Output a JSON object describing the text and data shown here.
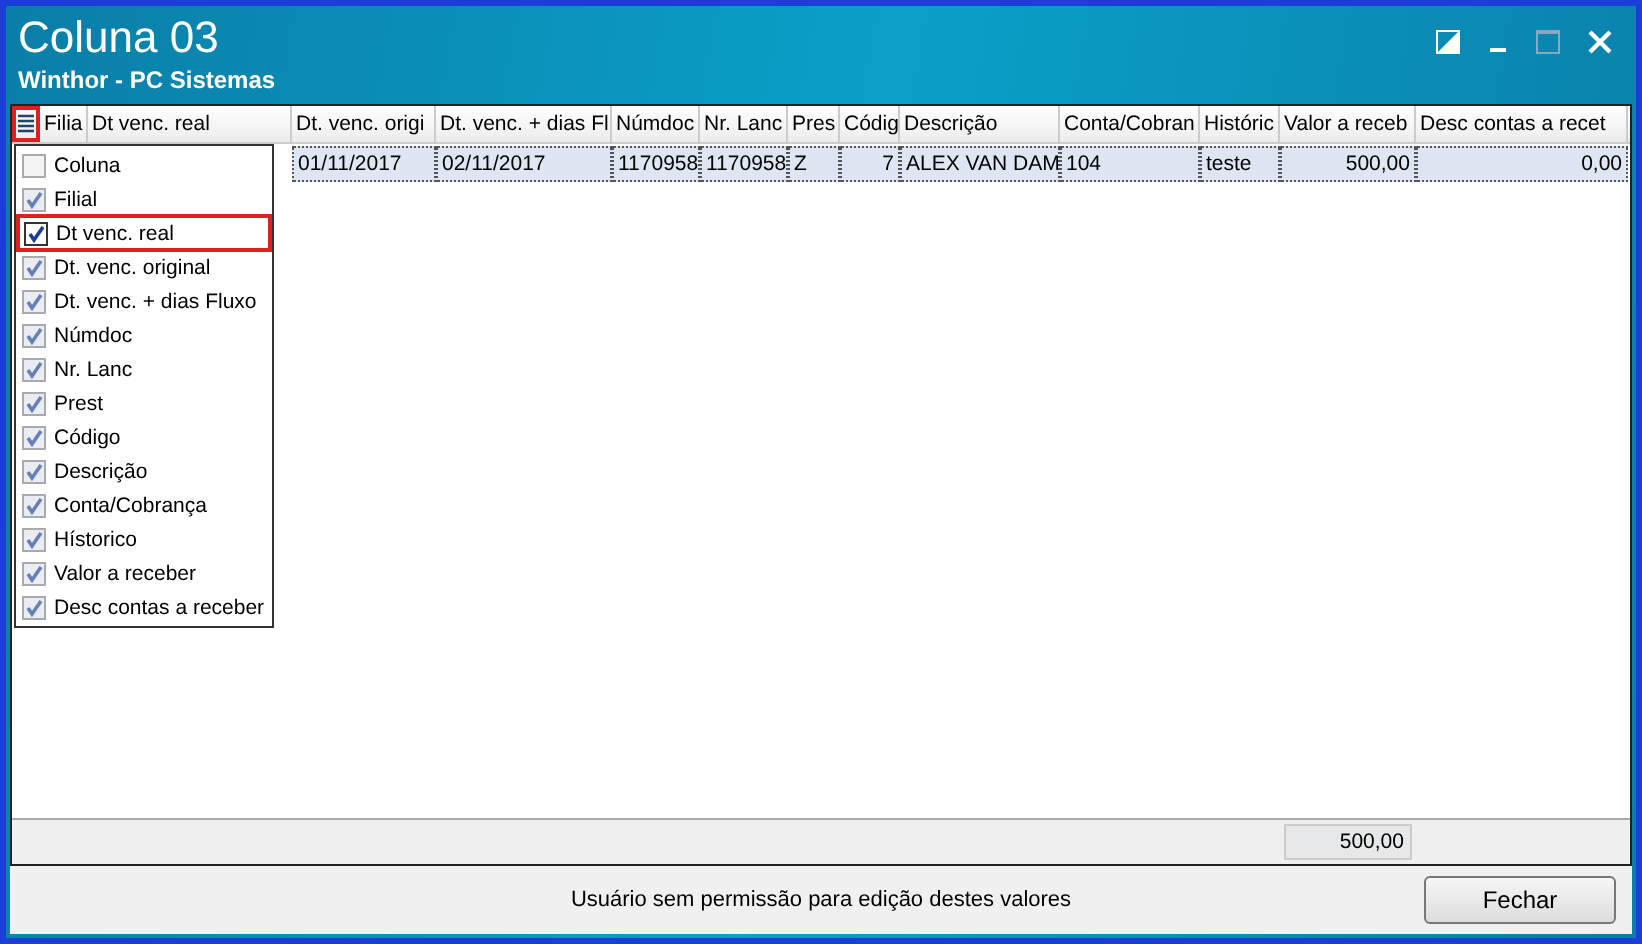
{
  "window": {
    "title": "Coluna 03",
    "subtitle": "Winthor - PC Sistemas"
  },
  "table": {
    "columns": [
      "Filia",
      "Dt venc. real",
      "Dt. venc. origi",
      "Dt. venc. + dias Fl",
      "Númdoc",
      "Nr. Lanc",
      "Pres",
      "Códig",
      "Descrição",
      "Conta/Cobran",
      "Históric",
      "Valor a receb",
      "Desc contas a recet"
    ],
    "rows": [
      {
        "selected": true,
        "cells": [
          "",
          "",
          "01/11/2017",
          "02/11/2017",
          "1170958",
          "1170958",
          "Z",
          "7",
          "ALEX VAN DAM",
          "104",
          "teste",
          "500,00",
          "0,00"
        ]
      }
    ],
    "total_value": "500,00"
  },
  "column_menu": {
    "items": [
      {
        "label": "Coluna",
        "checked": false,
        "selected": false
      },
      {
        "label": "Filial",
        "checked": true,
        "selected": false
      },
      {
        "label": "Dt venc. real",
        "checked": true,
        "selected": true
      },
      {
        "label": "Dt. venc. original",
        "checked": true,
        "selected": false
      },
      {
        "label": "Dt. venc.  + dias Fluxo",
        "checked": true,
        "selected": false
      },
      {
        "label": "Númdoc",
        "checked": true,
        "selected": false
      },
      {
        "label": "Nr. Lanc",
        "checked": true,
        "selected": false
      },
      {
        "label": "Prest",
        "checked": true,
        "selected": false
      },
      {
        "label": "Código",
        "checked": true,
        "selected": false
      },
      {
        "label": "Descrição",
        "checked": true,
        "selected": false
      },
      {
        "label": "Conta/Cobrança",
        "checked": true,
        "selected": false
      },
      {
        "label": "Hístorico",
        "checked": true,
        "selected": false
      },
      {
        "label": "Valor a receber",
        "checked": true,
        "selected": false
      },
      {
        "label": "Desc contas a receber",
        "checked": true,
        "selected": false
      }
    ]
  },
  "status_bar": {
    "message": "Usuário sem permissão para edição destes valores"
  },
  "buttons": [
    "Fechar"
  ]
}
